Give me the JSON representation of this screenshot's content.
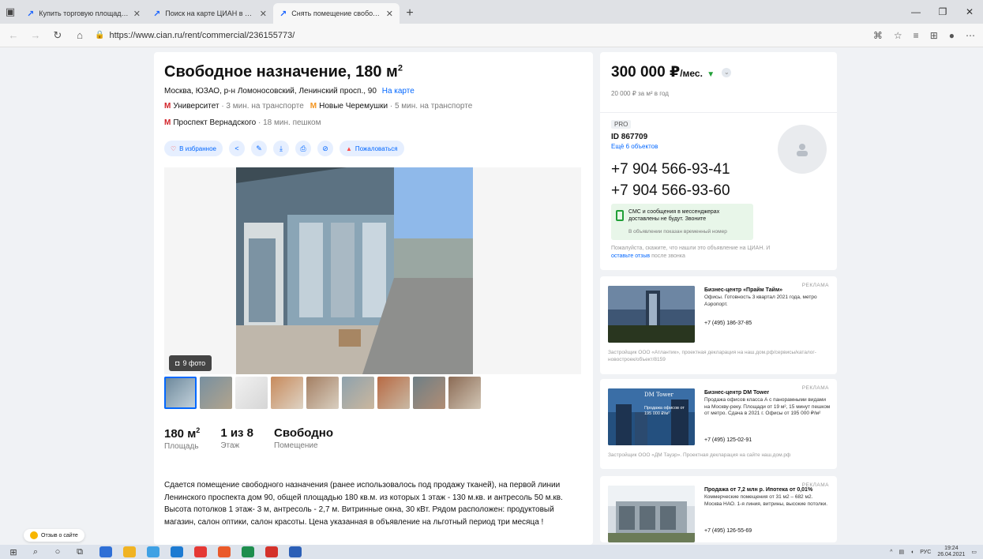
{
  "browser": {
    "tabs": [
      {
        "title": "Купить торговую площадь по",
        "active": false
      },
      {
        "title": "Поиск на карте ЦИАН в Моск",
        "active": false
      },
      {
        "title": "Снять помещение свободного",
        "active": true
      }
    ],
    "url_prefix": "https://",
    "url_domain": "www.cian.ru",
    "url_path": "/rent/commercial/236155773/"
  },
  "listing": {
    "title": "Свободное назначение, 180 м",
    "title_sup": "2",
    "address": "Москва, ЮЗАО, р-н Ломоносовский, Ленинский просп., 90",
    "map_link": "На карте",
    "metro": [
      {
        "name": "Университет",
        "dist": "· 3 мин. на транспорте"
      },
      {
        "name": "Новые Черемушки",
        "dist": "· 5 мин. на транспорте"
      },
      {
        "name": "Проспект Вернадского",
        "dist": "· 18 мин. пешком"
      }
    ],
    "actions": {
      "favorite": "В избранное",
      "complain": "Пожаловаться"
    },
    "photo_count": "9 фото",
    "stats": [
      {
        "value": "180 м",
        "sup": "2",
        "label": "Площадь"
      },
      {
        "value": "1 из 8",
        "sup": "",
        "label": "Этаж"
      },
      {
        "value": "Свободно",
        "sup": "",
        "label": "Помещение"
      }
    ],
    "description": "Сдается помещение свободного назначения (ранее использовалось под продажу тканей), на первой линии Ленинского проспекта дом 90, общей площадью 180 кв.м. из которых 1 этаж - 130 м.кв. и антресоль 50 м.кв. Высота потолков 1 этаж- 3 м, антресоль - 2,7 м. Витринные окна, 30 кВт. Рядом расположен: продуктовый магазин, салон оптики, салон красоты. Цена указанная в объявление на льготный период три месяца !"
  },
  "sidebar": {
    "price": "300 000 ₽",
    "price_per": "/мес.",
    "price_sqm": "20 000 ₽ за м² в год",
    "pro_badge": "PRO",
    "agent_id": "ID 867709",
    "agent_more": "Ещё 6 объектов",
    "phones": [
      "+7 904 566-93-41",
      "+7 904 566-93-60"
    ],
    "sms_text": "СМС и сообщения в мессенджерах доставлены не будут. Звоните",
    "sms_note": "В объявлении показан временный номер",
    "note_text": "Пожалуйста, скажите, что нашли это объявление на ЦИАН. И",
    "note_link": "оставьте отзыв",
    "note_tail": "после звонка"
  },
  "ads": [
    {
      "label": "РЕКЛАМА",
      "title": "Бизнес-центр «Прайм Тайм»",
      "text": "Офисы. Готовность 3 квартал 2021 года, метро Аэропорт.",
      "phone": "+7 (495) 186-37-85",
      "footer": "Застройщик ООО «Атлантик», проектная декларация на наш.дом.рф/сервисы/каталог-новостроек/объект/8159"
    },
    {
      "label": "РЕКЛАМА",
      "title": "Бизнес-центр DM Tower",
      "text": "Продажа офисов класса А с панорамными видами на Москву-реку. Площади от 19 м², 15 минут пешком от метро. Сдача в 2021 г. Офисы от 195 000 ₽/м²",
      "phone": "+7 (495) 125-02-91",
      "footer": "Застройщик ООО «ДМ Тауэр». Проектная декларация на сайте наш.дом.рф",
      "img_brand": "DM Tower",
      "img_caption": "Продажа офисов от 195 000 ₽/м²"
    },
    {
      "label": "РЕКЛАМА",
      "title": "Продажа от 7,2 млн р. Ипотека от 0,01%",
      "text": "Коммерческие помещения от 31 м2 – 682 м2. Москва НАО. 1-я линия, витрины, высокие потолки.",
      "phone": "+7 (495) 126-55-69",
      "footer": ""
    }
  ],
  "feedback": "Отзыв о сайте",
  "taskbar": {
    "lang": "РУС",
    "time": "19:24",
    "date": "26.04.2021"
  },
  "colors": {
    "accent": "#0468ff",
    "metro_red": "#d2242a",
    "metro_orange": "#f3941e",
    "green": "#21a038"
  }
}
